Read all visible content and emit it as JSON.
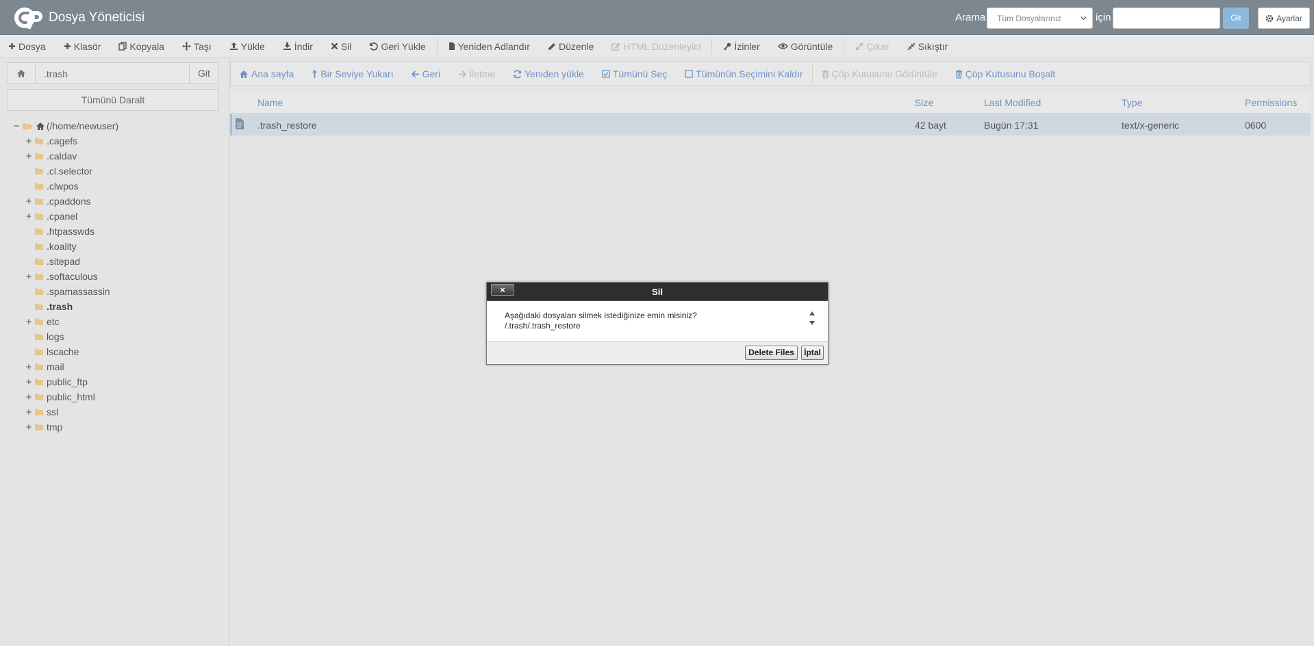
{
  "header": {
    "title": "Dosya Yöneticisi",
    "search_label": "Arama",
    "search_scope": "Tüm Dosyalarınız",
    "for_label": "için",
    "search_value": "",
    "go_label": "Git",
    "settings_label": "Ayarlar"
  },
  "toolbar": {
    "items": [
      {
        "label": "Dosya",
        "icon": "plus-icon",
        "enabled": true
      },
      {
        "label": "Klasör",
        "icon": "plus-icon",
        "enabled": true
      },
      {
        "label": "Kopyala",
        "icon": "copy-icon",
        "enabled": true
      },
      {
        "label": "Taşı",
        "icon": "move-icon",
        "enabled": true
      },
      {
        "label": "Yükle",
        "icon": "upload-icon",
        "enabled": true
      },
      {
        "label": "İndir",
        "icon": "download-icon",
        "enabled": true
      },
      {
        "label": "Sil",
        "icon": "times-icon",
        "enabled": true
      },
      {
        "label": "Geri Yükle",
        "icon": "undo-icon",
        "enabled": true
      },
      {
        "label": "Yeniden Adlandır",
        "icon": "file-icon",
        "enabled": true
      },
      {
        "label": "Düzenle",
        "icon": "pencil-icon",
        "enabled": true
      },
      {
        "label": "HTML Düzenleyici",
        "icon": "edit-icon",
        "enabled": false
      },
      {
        "label": "İzinler",
        "icon": "key-icon",
        "enabled": true
      },
      {
        "label": "Görüntüle",
        "icon": "eye-icon",
        "enabled": true
      },
      {
        "label": "Çıkar",
        "icon": "expand-icon",
        "enabled": false
      },
      {
        "label": "Sıkıştır",
        "icon": "compress-icon",
        "enabled": true
      }
    ]
  },
  "left_panel": {
    "path_value": ".trash",
    "go_label": "Git",
    "collapse_label": "Tümünü Daralt",
    "tree": [
      {
        "label": "(/home/newuser)",
        "toggle": "−",
        "level": 0,
        "root": true
      },
      {
        "label": ".cagefs",
        "toggle": "+",
        "level": 1
      },
      {
        "label": ".caldav",
        "toggle": "+",
        "level": 1
      },
      {
        "label": ".cl.selector",
        "toggle": "",
        "level": 1
      },
      {
        "label": ".clwpos",
        "toggle": "",
        "level": 1
      },
      {
        "label": ".cpaddons",
        "toggle": "+",
        "level": 1
      },
      {
        "label": ".cpanel",
        "toggle": "+",
        "level": 1
      },
      {
        "label": ".htpasswds",
        "toggle": "",
        "level": 1
      },
      {
        "label": ".koality",
        "toggle": "",
        "level": 1
      },
      {
        "label": ".sitepad",
        "toggle": "",
        "level": 1
      },
      {
        "label": ".softaculous",
        "toggle": "+",
        "level": 1
      },
      {
        "label": ".spamassassin",
        "toggle": "",
        "level": 1
      },
      {
        "label": ".trash",
        "toggle": "",
        "level": 1,
        "current": true
      },
      {
        "label": "etc",
        "toggle": "+",
        "level": 1
      },
      {
        "label": "logs",
        "toggle": "",
        "level": 1
      },
      {
        "label": "lscache",
        "toggle": "",
        "level": 1
      },
      {
        "label": "mail",
        "toggle": "+",
        "level": 1
      },
      {
        "label": "public_ftp",
        "toggle": "+",
        "level": 1
      },
      {
        "label": "public_html",
        "toggle": "+",
        "level": 1
      },
      {
        "label": "ssl",
        "toggle": "+",
        "level": 1
      },
      {
        "label": "tmp",
        "toggle": "+",
        "level": 1
      }
    ]
  },
  "actionbar": {
    "items": [
      {
        "label": "Ana sayfa",
        "icon": "home-icon",
        "enabled": true
      },
      {
        "label": "Bir Seviye Yukarı",
        "icon": "level-up-icon",
        "enabled": true
      },
      {
        "label": "Geri",
        "icon": "arrow-left-icon",
        "enabled": true
      },
      {
        "label": "İletme",
        "icon": "arrow-right-icon",
        "enabled": false
      },
      {
        "label": "Yeniden yükle",
        "icon": "refresh-icon",
        "enabled": true
      },
      {
        "label": "Tümünü Seç",
        "icon": "checkbox-checked-icon",
        "enabled": true
      },
      {
        "label": "Tümünün Seçimini Kaldır",
        "icon": "checkbox-empty-icon",
        "enabled": true
      },
      {
        "label": "Çöp Kutusunu Görüntüle",
        "icon": "trash-icon",
        "enabled": false
      },
      {
        "label": "Çöp Kutusunu Boşalt",
        "icon": "trash-icon",
        "enabled": true
      }
    ]
  },
  "table": {
    "columns": {
      "name": "Name",
      "size": "Size",
      "modified": "Last Modified",
      "type": "Type",
      "permissions": "Permissions"
    },
    "rows": [
      {
        "name": ".trash_restore",
        "size": "42 bayt",
        "modified": "Bugün 17:31",
        "type": "text/x-generic",
        "permissions": "0600",
        "selected": true
      }
    ]
  },
  "dialog": {
    "title": "Sil",
    "close_label": "×",
    "message": "Aşağıdaki dosyaları silmek istediğinize emin misiniz?",
    "file_path": "/.trash/.trash_restore",
    "confirm_label": "Delete Files",
    "cancel_label": "İptal"
  },
  "colors": {
    "header_bg": "#7d8790",
    "link_blue": "#6a93c6",
    "folder": "#e6c68b",
    "selected_row": "#cfd8e1",
    "dialog_header": "#2f2f2f"
  }
}
